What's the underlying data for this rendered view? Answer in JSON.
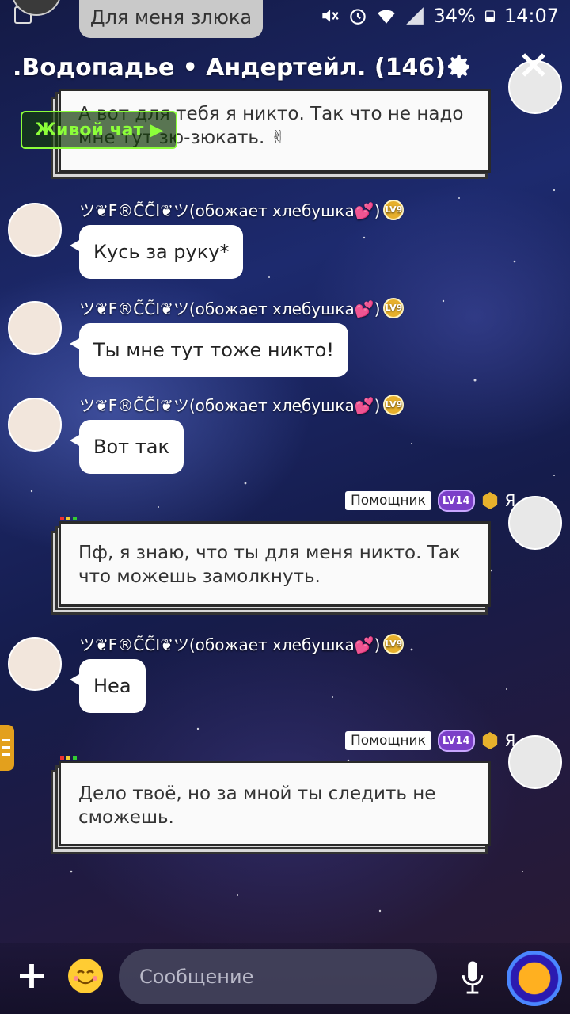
{
  "status_bar": {
    "battery": "34%",
    "time": "14:07"
  },
  "preview": {
    "text": "Для меня злюка"
  },
  "header": {
    "title": ".Водопадье • Андертейл. (146)",
    "live_chat": "Живой чат",
    "overlap_helper": "Помощник",
    "overlap_me": "Я"
  },
  "messages": [
    {
      "type": "mine",
      "text": "А вот для тебя я никто. Так что не надо мне тут зю-зюкать. ✌"
    },
    {
      "type": "theirs",
      "author": "ツ❦F®C̃C̃I❦ツ(обожает хлебушка💕)",
      "level": "LV9",
      "text": "Кусь за руку*"
    },
    {
      "type": "theirs",
      "author": "ツ❦F®C̃C̃I❦ツ(обожает хлебушка💕)",
      "level": "LV9",
      "text": "Ты мне тут тоже никто!"
    },
    {
      "type": "theirs",
      "author": "ツ❦F®C̃C̃I❦ツ(обожает хлебушка💕)",
      "level": "LV9",
      "text": "Вот так"
    },
    {
      "type": "mine",
      "helper": "Помощник",
      "level": "LV14",
      "me": "Я",
      "line1": "Пф, я знаю, что ты для меня никто. Так",
      "line2": "что можешь замолкнуть."
    },
    {
      "type": "theirs",
      "author": "ツ❦F®C̃C̃I❦ツ(обожает хлебушка💕)",
      "level": "LV9",
      "text": "Неа"
    },
    {
      "type": "mine",
      "helper": "Помощник",
      "level": "LV14",
      "me": "Я",
      "line1": "Дело твоё, но за мной ты следить не",
      "line2": "сможешь."
    }
  ],
  "top_message": {
    "line1": "А вот для тебя я никто. Так что не надо",
    "line2": "мне тут зю-зюкать. ✌"
  },
  "composer": {
    "placeholder": "Сообщение"
  },
  "icons": {
    "mute": "mute-icon",
    "alarm": "alarm-icon",
    "wifi": "wifi-icon",
    "signal": "signal-icon",
    "battery": "battery-icon",
    "settings": "gear-icon",
    "close": "close-icon",
    "add": "plus-icon",
    "sticker": "emoji-icon",
    "voice": "mic-icon",
    "amino": "amino-coin-icon"
  },
  "colors": {
    "live_chat": "#8cff3a",
    "level_gold": "#e7b02c",
    "level_purple": "#7b3fc8"
  }
}
